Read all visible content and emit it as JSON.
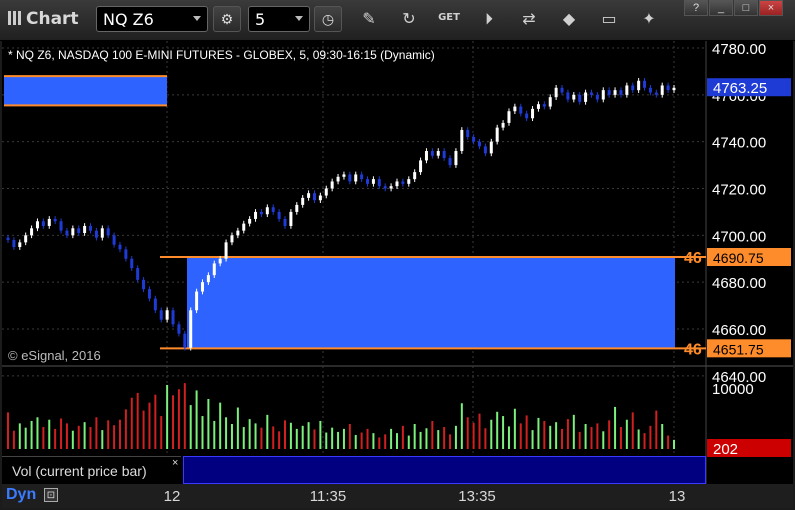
{
  "app": {
    "title": "Chart"
  },
  "toolbar": {
    "symbol": "NQ Z6",
    "interval": "5",
    "icons": [
      "settings-icon",
      "clock-icon",
      "pencil-icon",
      "refresh-icon",
      "get-icon",
      "play-icon",
      "compare-icon",
      "tag-icon",
      "comment-icon",
      "twitter-icon"
    ],
    "get_label": "GET",
    "window_buttons": [
      "?",
      "_",
      "□",
      "×"
    ]
  },
  "chart_data": {
    "type": "candlestick",
    "title": "* NQ Z6, NASDAQ 100 E-MINI FUTURES - GLOBEX, 5, 09:30-16:15 (Dynamic)",
    "watermark": "© eSignal, 2016",
    "price_axis": {
      "ticks": [
        "4780.00",
        "4760.00",
        "4740.00",
        "4720.00",
        "4700.00",
        "4680.00",
        "4660.00",
        "4640.00"
      ],
      "range": [
        4640,
        4785
      ]
    },
    "last_price": "4763.25",
    "zones": [
      {
        "side": "left",
        "low": 4755.5,
        "high": 4768.0
      },
      {
        "side": "main",
        "low": 4651.75,
        "high": 4690.75
      }
    ],
    "zone_labels": [
      {
        "price": "4690.75",
        "count": "46"
      },
      {
        "price": "4651.75",
        "count": "46"
      }
    ],
    "colors": {
      "up": "#ffffff",
      "down": "#1f3bd6",
      "zone": "#2e63ff",
      "line": "#ff8c2a",
      "last": "#1f3bd6",
      "vol_up": "#7cf07c",
      "vol_down": "#d02020"
    },
    "volume_axis": {
      "ticks": [
        "10000"
      ]
    },
    "volume_last": "202",
    "volume_label": "Vol (current price bar)",
    "time_labels": [
      "12",
      "11:35",
      "13:35",
      "13"
    ],
    "closes": [
      4698,
      4695,
      4697,
      4700,
      4703,
      4706,
      4704,
      4707,
      4706,
      4702,
      4700,
      4703,
      4701,
      4704,
      4702,
      4699,
      4703,
      4700,
      4696,
      4694,
      4690,
      4686,
      4681,
      4677,
      4673,
      4668,
      4664,
      4668,
      4662,
      4658,
      4652,
      4668,
      4676,
      4680,
      4683,
      4688,
      4690,
      4697,
      4700,
      4702,
      4705,
      4707,
      4710,
      4709,
      4712,
      4710,
      4707,
      4704,
      4710,
      4713,
      4716,
      4718,
      4715,
      4717,
      4720,
      4723,
      4725,
      4726,
      4723,
      4726,
      4724,
      4722,
      4724,
      4721,
      4720,
      4721,
      4723,
      4722,
      4724,
      4727,
      4732,
      4736,
      4734,
      4736,
      4733,
      4730,
      4736,
      4745,
      4742,
      4740,
      4738,
      4735,
      4740,
      4746,
      4748,
      4753,
      4755,
      4752,
      4750,
      4754,
      4756,
      4755,
      4759,
      4763,
      4761,
      4758,
      4760,
      4757,
      4761,
      4760,
      4758,
      4762,
      4760,
      4762,
      4760,
      4764,
      4762,
      4766,
      4763,
      4761,
      4760,
      4764,
      4762,
      4763
    ],
    "volumes": [
      6000,
      3000,
      4200,
      3500,
      4600,
      5200,
      3600,
      4800,
      3300,
      5000,
      4200,
      3000,
      3800,
      4400,
      3600,
      5200,
      3100,
      4700,
      3900,
      4800,
      6500,
      8400,
      9200,
      6300,
      7600,
      8900,
      5400,
      10500,
      8800,
      9800,
      10800,
      7200,
      9600,
      5400,
      8200,
      4600,
      7600,
      5200,
      4100,
      6800,
      3600,
      4900,
      4200,
      3500,
      5600,
      3700,
      2900,
      4700,
      4300,
      3300,
      3800,
      4400,
      3200,
      4600,
      2700,
      3500,
      2800,
      3300,
      4100,
      2300,
      2700,
      3300,
      2600,
      1900,
      2400,
      3300,
      2600,
      3800,
      2200,
      4100,
      2800,
      3400,
      4600,
      3100,
      3600,
      2400,
      3800,
      7500,
      5200,
      4300,
      5800,
      3400,
      4800,
      6100,
      5400,
      3700,
      6600,
      4200,
      5500,
      3100,
      5100,
      4600,
      3800,
      4400,
      3300,
      4900,
      5600,
      2800,
      4100,
      3600,
      4200,
      2900,
      4700,
      6900,
      3600,
      4800,
      6000,
      3200,
      2600,
      3800,
      6300,
      4100,
      2200,
      1500
    ]
  }
}
